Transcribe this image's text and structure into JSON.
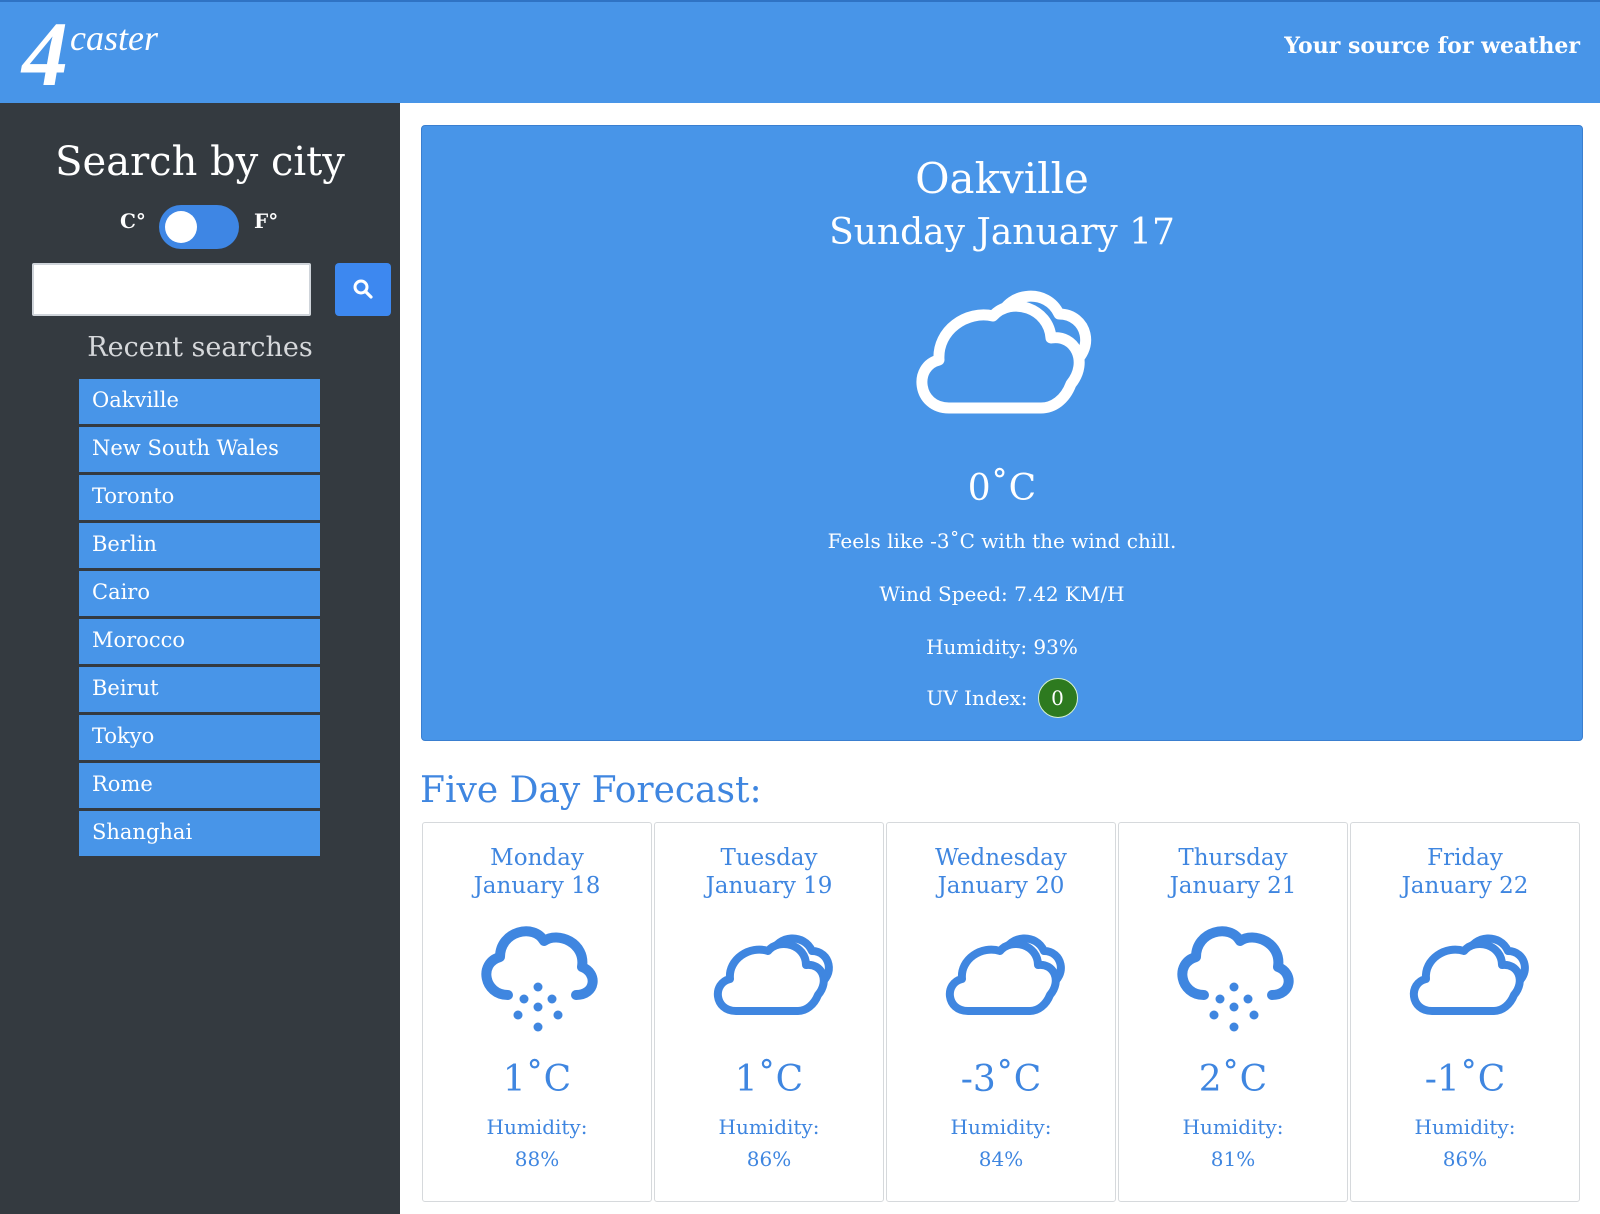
{
  "header": {
    "logo_number": "4",
    "logo_word": "caster",
    "tagline": "Your source for weather"
  },
  "sidebar": {
    "title": "Search by city",
    "unit_celsius": "C°",
    "unit_fahrenheit": "F°",
    "unit_toggle_state": "celsius",
    "search_input_value": "",
    "search_icon": "search-icon",
    "recent_title": "Recent searches",
    "recent": [
      "Oakville",
      "New South Wales",
      "Toronto",
      "Berlin",
      "Cairo",
      "Morocco",
      "Beirut",
      "Tokyo",
      "Rome",
      "Shanghai"
    ]
  },
  "current": {
    "city": "Oakville",
    "date": "Sunday January 17",
    "icon": "partly-cloudy-icon",
    "temperature": "0˚C",
    "feels_like": "Feels like -3˚C with the wind chill.",
    "wind_speed": "Wind Speed: 7.42 KM/H",
    "humidity": "Humidity: 93%",
    "uv_label": "UV Index:",
    "uv_value": "0"
  },
  "forecast": {
    "title": "Five Day Forecast:",
    "days": [
      {
        "day": "Monday",
        "date": "January 18",
        "icon": "snow-icon",
        "temp": "1˚C",
        "humidity_label": "Humidity:",
        "humidity": "88%"
      },
      {
        "day": "Tuesday",
        "date": "January 19",
        "icon": "cloudy-icon",
        "temp": "1˚C",
        "humidity_label": "Humidity:",
        "humidity": "86%"
      },
      {
        "day": "Wednesday",
        "date": "January 20",
        "icon": "cloudy-icon",
        "temp": "-3˚C",
        "humidity_label": "Humidity:",
        "humidity": "84%"
      },
      {
        "day": "Thursday",
        "date": "January 21",
        "icon": "snow-icon",
        "temp": "2˚C",
        "humidity_label": "Humidity:",
        "humidity": "81%"
      },
      {
        "day": "Friday",
        "date": "January 22",
        "icon": "cloudy-icon",
        "temp": "-1˚C",
        "humidity_label": "Humidity:",
        "humidity": "86%"
      }
    ]
  },
  "colors": {
    "brand_blue": "#4895e8",
    "sidebar_dark": "#343a40",
    "forecast_text": "#3f86e0",
    "uv_green": "#2d7a1f"
  }
}
